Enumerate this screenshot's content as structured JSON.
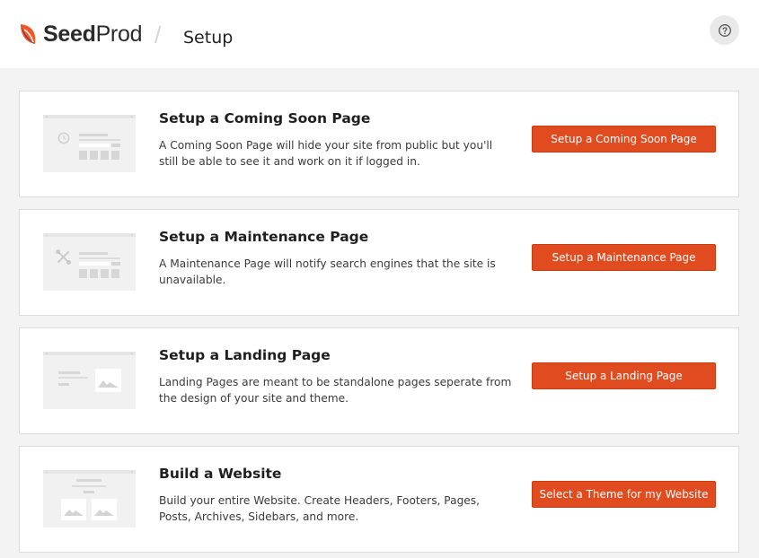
{
  "header": {
    "logo_text": "SeedProd",
    "logo_bold": "Seed",
    "logo_light": "Prod",
    "page_title": "Setup",
    "help_icon": "question-circle-icon"
  },
  "colors": {
    "accent": "#e04b1f",
    "logo_orange": "#f15a24",
    "logo_purple": "#6a2e6e",
    "background": "#f3f3f3"
  },
  "cards": [
    {
      "title": "Setup a Coming Soon Page",
      "description": "A Coming Soon Page will hide your site from public but you'll still be able to see it and work on it if logged in.",
      "button_label": "Setup a Coming Soon Page",
      "illustration": "clock-icon"
    },
    {
      "title": "Setup a Maintenance Page",
      "description": "A Maintenance Page will notify search engines that the site is unavailable.",
      "button_label": "Setup a Maintenance Page",
      "illustration": "tools-icon"
    },
    {
      "title": "Setup a Landing Page",
      "description": "Landing Pages are meant to be standalone pages seperate from the design of your site and theme.",
      "button_label": "Setup a Landing Page",
      "illustration": "image-icon"
    },
    {
      "title": "Build a Website",
      "description": "Build your entire Website. Create Headers, Footers, Pages, Posts, Archives, Sidebars, and more.",
      "button_label": "Select a Theme for my Website",
      "illustration": "image-icon"
    }
  ]
}
